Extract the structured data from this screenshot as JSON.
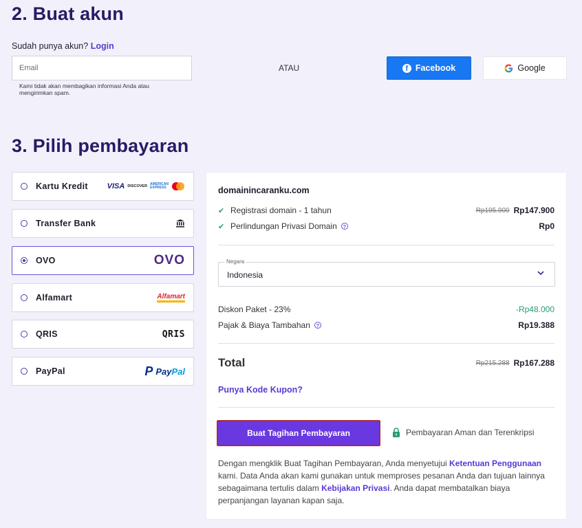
{
  "account": {
    "title": "2. Buat akun",
    "have_account": "Sudah punya akun?",
    "login": "Login",
    "email_placeholder": "Email",
    "email_note": "Kami tidak akan membagikan informasi Anda atau mengirimkan spam.",
    "or": "ATAU",
    "facebook": "Facebook",
    "google": "Google"
  },
  "payment": {
    "title": "3. Pilih pembayaran",
    "options": [
      {
        "label": "Kartu Kredit",
        "selected": false
      },
      {
        "label": "Transfer Bank",
        "selected": false
      },
      {
        "label": "OVO",
        "selected": true
      },
      {
        "label": "Alfamart",
        "selected": false
      },
      {
        "label": "QRIS",
        "selected": false
      },
      {
        "label": "PayPal",
        "selected": false
      }
    ],
    "logos": {
      "visa": "VISA",
      "discover": "DISCOVER",
      "amex_top": "AMERICAN",
      "amex_bottom": "EXPRESS",
      "ovo": "OVO",
      "alfamart": "Alfamart",
      "qris": "QRIS",
      "paypal_pay": "Pay",
      "paypal_pal": "Pal"
    }
  },
  "summary": {
    "domain": "domainincaranku.com",
    "items": [
      {
        "label": "Registrasi domain - 1 tahun",
        "old_price": "Rp195.900",
        "price": "Rp147.900"
      },
      {
        "label": "Perlindungan Privasi Domain",
        "price": "Rp0"
      }
    ],
    "country_legend": "Negara",
    "country_value": "Indonesia",
    "discount_label": "Diskon Paket - 23%",
    "discount_value": "-Rp48.000",
    "tax_label": "Pajak & Biaya Tambahan",
    "tax_value": "Rp19.388",
    "total_label": "Total",
    "total_old": "Rp215.288",
    "total_value": "Rp167.288",
    "coupon": "Punya Kode Kupon?",
    "button": "Buat Tagihan Pembayaran",
    "secure": "Pembayaran Aman dan Terenkripsi",
    "terms_1": "Dengan mengklik Buat Tagihan Pembayaran, Anda menyetujui ",
    "terms_link_1": "Ketentuan Penggunaan",
    "terms_2": " kami. Data Anda akan kami gunakan untuk memproses pesanan Anda dan tujuan lainnya sebagaimana tertulis dalam ",
    "terms_link_2": "Kebijakan Privasi",
    "terms_3": ". Anda dapat membatalkan biaya perpanjangan layanan kapan saja."
  },
  "colors": {
    "accent": "#6a38e0",
    "heading": "#2a1a66",
    "facebook": "#1877f2",
    "discount": "#2a9a7a"
  }
}
